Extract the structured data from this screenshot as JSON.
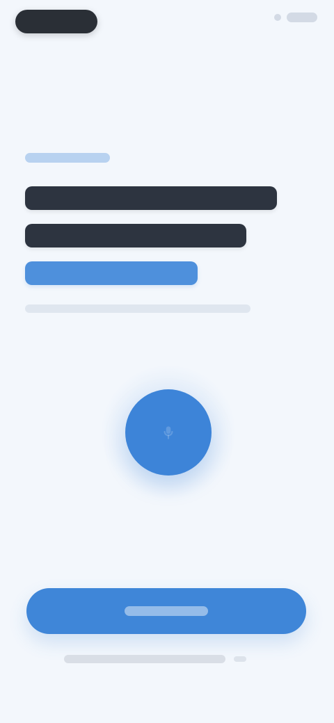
{
  "theme": {
    "background": "#f3f7fc",
    "primary": "#3d84d8",
    "dark_text_block": "#2d3440",
    "accent_text_block": "#4e90dc"
  },
  "icons": {
    "microphone": "microphone-icon"
  }
}
